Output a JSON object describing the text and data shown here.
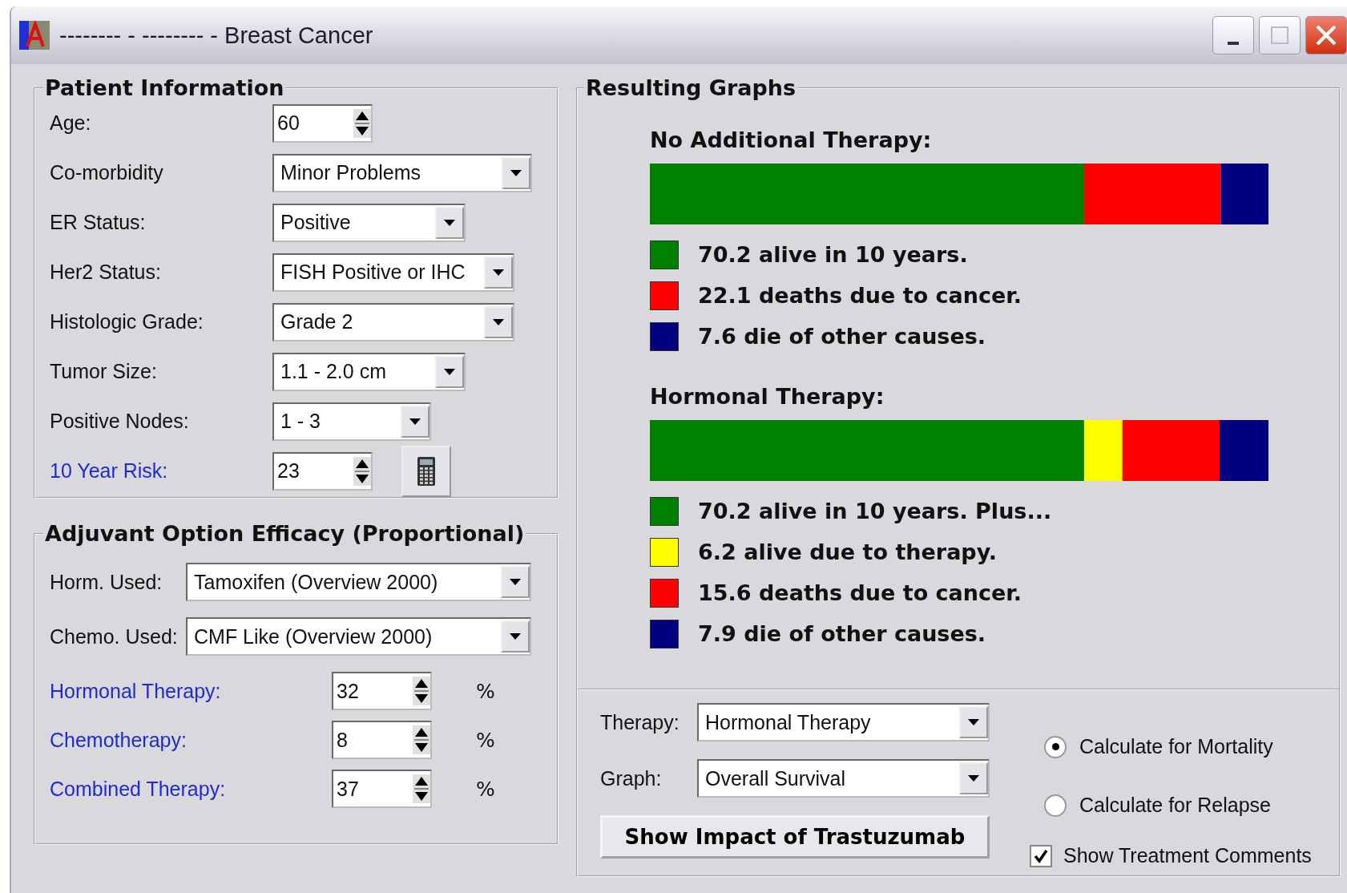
{
  "window": {
    "title": "-------- - -------- - Breast Cancer"
  },
  "patient_information": {
    "title": "Patient Information",
    "fields": [
      {
        "label": "Age:",
        "kind": "spin",
        "value": "60",
        "link": false
      },
      {
        "label": "Co-morbidity",
        "kind": "dropdown",
        "value": "Minor Problems",
        "link": false
      },
      {
        "label": "ER Status:",
        "kind": "dropdown",
        "value": "Positive",
        "link": false
      },
      {
        "label": "Her2 Status:",
        "kind": "dropdown",
        "value": "FISH Positive or IHC",
        "link": false
      },
      {
        "label": "Histologic Grade:",
        "kind": "dropdown",
        "value": "Grade 2",
        "link": false
      },
      {
        "label": "Tumor Size:",
        "kind": "dropdown",
        "value": "1.1 - 2.0 cm",
        "link": false
      },
      {
        "label": "Positive Nodes:",
        "kind": "dropdown",
        "value": "1 - 3",
        "link": false
      },
      {
        "label": "10 Year Risk:",
        "kind": "spin_calc",
        "value": "23",
        "link": true
      }
    ]
  },
  "adjuvant": {
    "title": "Adjuvant Option Efficacy (Proportional)",
    "options": [
      {
        "label": "Horm. Used:",
        "value": "Tamoxifen (Overview 2000)"
      },
      {
        "label": "Chemo. Used:",
        "value": "CMF Like (Overview 2000)"
      }
    ],
    "efficacy": [
      {
        "label": "Hormonal Therapy:",
        "value": "32",
        "unit": "%"
      },
      {
        "label": "Chemotherapy:",
        "value": "8",
        "unit": "%"
      },
      {
        "label": "Combined Therapy:",
        "value": "37",
        "unit": "%"
      }
    ]
  },
  "resulting_graphs": {
    "title": "Resulting Graphs",
    "graphs": [
      {
        "title": "No Additional Therapy:",
        "items": [
          {
            "text": "70.2 alive in 10 years.",
            "color": "#008000"
          },
          {
            "text": "22.1 deaths due to cancer.",
            "color": "#ff0000"
          },
          {
            "text": "7.6 die of other causes.",
            "color": "#000080"
          }
        ]
      },
      {
        "title": "Hormonal Therapy:",
        "items": [
          {
            "text": "70.2 alive in 10 years. Plus...",
            "color": "#008000"
          },
          {
            "text": "6.2 alive due to therapy.",
            "color": "#ffff00"
          },
          {
            "text": "15.6 deaths due to cancer.",
            "color": "#ff0000"
          },
          {
            "text": "7.9 die of other causes.",
            "color": "#000080"
          }
        ]
      }
    ]
  },
  "controls": {
    "selectors": [
      {
        "label": "Therapy:",
        "value": "Hormonal Therapy"
      },
      {
        "label": "Graph:",
        "value": "Overall Survival"
      }
    ],
    "button": "Show Impact of Trastuzumab",
    "radios": [
      {
        "label": "Calculate for Mortality",
        "selected": true
      },
      {
        "label": "Calculate for Relapse",
        "selected": false
      }
    ],
    "checkbox": {
      "label": "Show Treatment Comments",
      "checked": true
    }
  }
}
